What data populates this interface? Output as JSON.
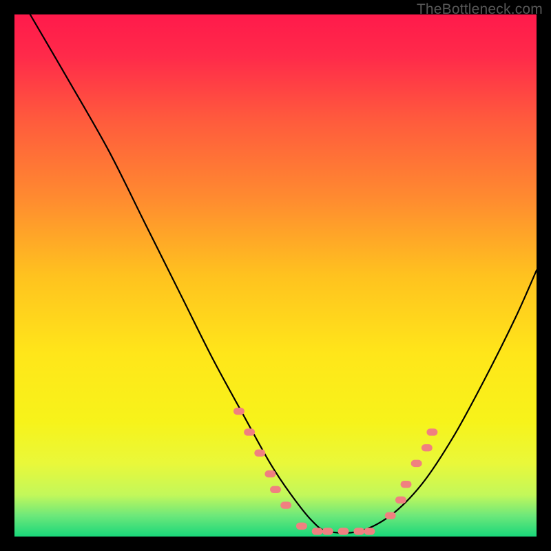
{
  "watermark": "TheBottleneck.com",
  "chart_data": {
    "type": "line",
    "title": "",
    "xlabel": "",
    "ylabel": "",
    "xlim": [
      0,
      100
    ],
    "ylim": [
      0,
      100
    ],
    "gradient_stops": [
      {
        "offset": 0.0,
        "color": "#ff1a4b"
      },
      {
        "offset": 0.08,
        "color": "#ff2a4a"
      },
      {
        "offset": 0.2,
        "color": "#ff5a3d"
      },
      {
        "offset": 0.35,
        "color": "#ff8a30"
      },
      {
        "offset": 0.5,
        "color": "#ffc21f"
      },
      {
        "offset": 0.65,
        "color": "#ffe61a"
      },
      {
        "offset": 0.78,
        "color": "#f7f31a"
      },
      {
        "offset": 0.86,
        "color": "#e9f83a"
      },
      {
        "offset": 0.92,
        "color": "#c3f85a"
      },
      {
        "offset": 0.96,
        "color": "#6de87a"
      },
      {
        "offset": 1.0,
        "color": "#19d77a"
      }
    ],
    "series": [
      {
        "name": "bottleneck-curve",
        "color": "#000000",
        "x": [
          3,
          10,
          18,
          25,
          32,
          38,
          44,
          49,
          53,
          57,
          60,
          66,
          72,
          78,
          84,
          90,
          96,
          100
        ],
        "values": [
          100,
          88,
          74,
          60,
          46,
          34,
          23,
          14,
          8,
          3,
          1,
          1,
          4,
          10,
          19,
          30,
          42,
          51
        ]
      }
    ],
    "markers": {
      "name": "highlight-dots",
      "color": "#f08080",
      "radius": 8,
      "points": [
        {
          "x": 43,
          "y": 24
        },
        {
          "x": 45,
          "y": 20
        },
        {
          "x": 47,
          "y": 16
        },
        {
          "x": 49,
          "y": 12
        },
        {
          "x": 50,
          "y": 9
        },
        {
          "x": 52,
          "y": 6
        },
        {
          "x": 55,
          "y": 2
        },
        {
          "x": 58,
          "y": 1
        },
        {
          "x": 60,
          "y": 1
        },
        {
          "x": 63,
          "y": 1
        },
        {
          "x": 66,
          "y": 1
        },
        {
          "x": 68,
          "y": 1
        },
        {
          "x": 72,
          "y": 4
        },
        {
          "x": 74,
          "y": 7
        },
        {
          "x": 75,
          "y": 10
        },
        {
          "x": 77,
          "y": 14
        },
        {
          "x": 79,
          "y": 17
        },
        {
          "x": 80,
          "y": 20
        }
      ]
    }
  }
}
